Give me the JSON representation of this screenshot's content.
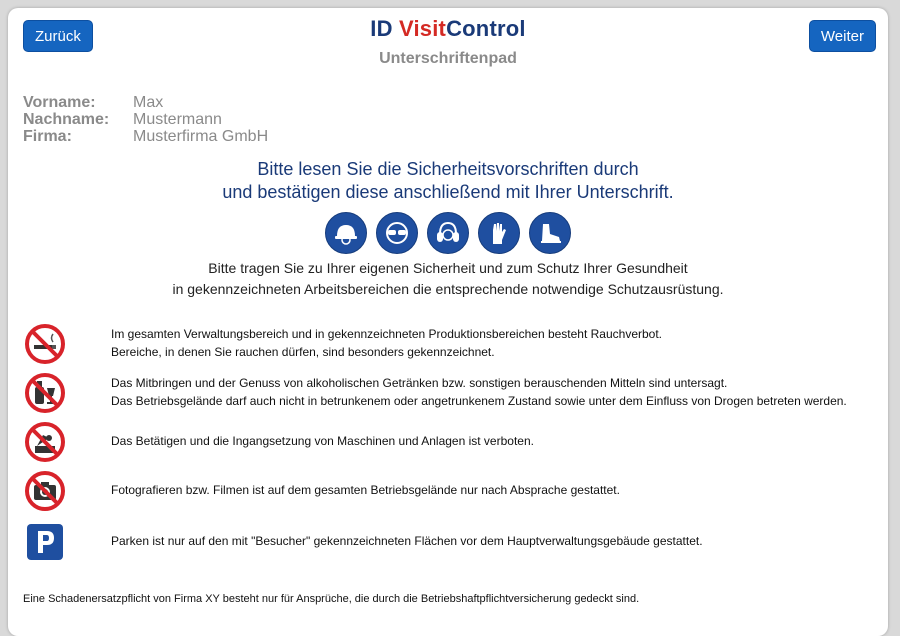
{
  "header": {
    "back_label": "Zurück",
    "next_label": "Weiter",
    "logo_part1": "ID ",
    "logo_part2": "Visit",
    "logo_part3": "Control",
    "subtitle": "Unterschriftenpad"
  },
  "person": {
    "first_name_label": "Vorname:",
    "first_name": "Max",
    "last_name_label": "Nachname:",
    "last_name": "Mustermann",
    "company_label": "Firma:",
    "company": "Musterfirma GmbH"
  },
  "intro": {
    "line1": "Bitte lesen Sie die Sicherheitsvorschriften durch",
    "line2": "und bestätigen diese anschließend mit Ihrer Unterschrift."
  },
  "ppe": {
    "icons": [
      "hard-hat-icon",
      "safety-glasses-icon",
      "ear-protection-icon",
      "gloves-icon",
      "safety-boots-icon"
    ],
    "line1": "Bitte tragen Sie zu Ihrer eigenen Sicherheit und zum Schutz Ihrer Gesundheit",
    "line2": "in gekennzeichneten Arbeitsbereichen die entsprechende notwendige Schutzausrüstung."
  },
  "rules": [
    {
      "icon": "no-smoking-icon",
      "line1": "Im gesamten Verwaltungsbereich und in gekennzeichneten Produktionsbereichen besteht Rauchverbot.",
      "line2": "Bereiche, in denen Sie rauchen dürfen, sind besonders gekennzeichnet."
    },
    {
      "icon": "no-alcohol-icon",
      "line1": "Das Mitbringen und der Genuss von alkoholischen Getränken bzw. sonstigen berauschenden Mitteln sind untersagt.",
      "line2": "Das Betriebsgelände darf auch nicht in betrunkenem oder angetrunkenem Zustand sowie unter dem Einfluss von Drogen betreten werden."
    },
    {
      "icon": "no-machine-operation-icon",
      "line1": "Das Betätigen und die Ingangsetzung von Maschinen und Anlagen ist verboten."
    },
    {
      "icon": "no-photography-icon",
      "line1": "Fotografieren bzw. Filmen ist auf dem gesamten Betriebsgelände nur nach Absprache gestattet."
    },
    {
      "icon": "parking-icon",
      "line1": "Parken ist nur auf den mit \"Besucher\" gekennzeichneten Flächen vor dem Hauptverwaltungsgebäude gestattet."
    }
  ],
  "footer": "Eine Schadenersatzpflicht von Firma XY besteht nur für Ansprüche, die durch die Betriebshaftpflichtversicherung gedeckt sind.",
  "colors": {
    "button": "#1565c0",
    "brand_blue": "#1a3a78",
    "brand_red": "#d42a24",
    "prohibition_red": "#d8232a",
    "ppe_blue": "#1f4fa0"
  }
}
